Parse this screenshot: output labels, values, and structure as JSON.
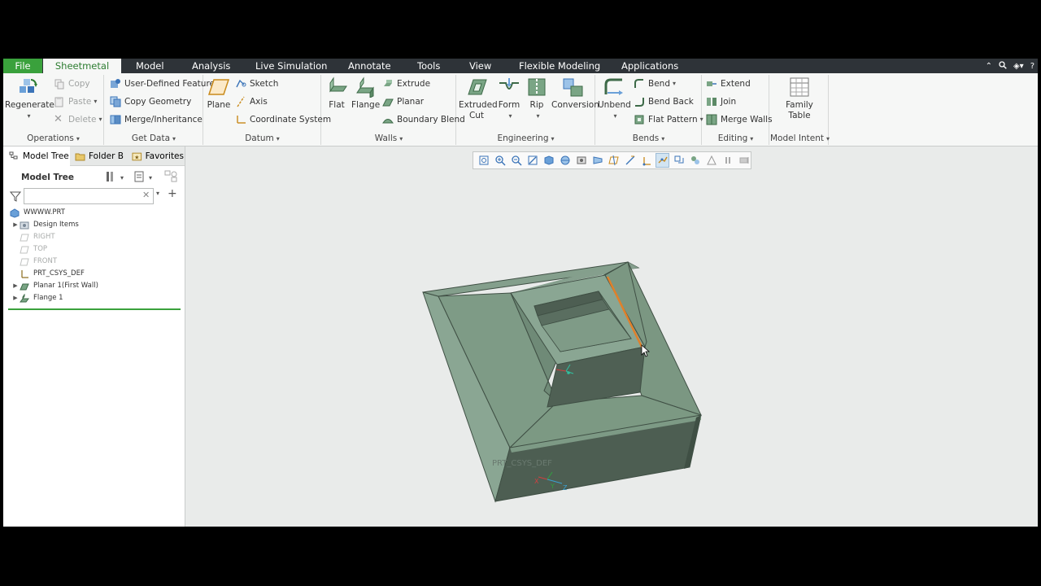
{
  "menu": {
    "file": "File",
    "tabs": [
      "Sheetmetal",
      "Model",
      "Analysis",
      "Live Simulation",
      "Annotate",
      "Tools",
      "View",
      "Flexible Modeling",
      "Applications"
    ],
    "right_icons": [
      "collapse-ribbon-icon",
      "search-icon",
      "settings-icon",
      "help-icon"
    ]
  },
  "ribbon": {
    "operations": {
      "label": "Operations",
      "regenerate": "Regenerate",
      "copy": "Copy",
      "paste": "Paste",
      "delete": "Delete"
    },
    "get_data": {
      "label": "Get Data",
      "udf": "User-Defined Feature",
      "copy_geometry": "Copy Geometry",
      "merge": "Merge/Inheritance"
    },
    "datum": {
      "label": "Datum",
      "plane": "Plane",
      "sketch": "Sketch",
      "axis": "Axis",
      "csys": "Coordinate System"
    },
    "walls": {
      "label": "Walls",
      "flat": "Flat",
      "flange": "Flange",
      "extrude": "Extrude",
      "planar": "Planar",
      "boundary_blend": "Boundary Blend"
    },
    "engineering": {
      "label": "Engineering",
      "extruded_cut_1": "Extruded",
      "extruded_cut_2": "Cut",
      "form": "Form",
      "rip": "Rip",
      "conversion": "Conversion"
    },
    "bends": {
      "label": "Bends",
      "unbend": "Unbend",
      "bend": "Bend",
      "bend_back": "Bend Back",
      "flat_pattern": "Flat Pattern"
    },
    "editing": {
      "label": "Editing",
      "extend": "Extend",
      "join": "Join",
      "merge_walls": "Merge Walls"
    },
    "model_intent": {
      "label": "Model Intent",
      "family_table_1": "Family",
      "family_table_2": "Table"
    }
  },
  "left_panel": {
    "tabs": [
      "Model Tree",
      "Folder B",
      "Favorites"
    ],
    "header": "Model Tree",
    "search": {
      "value": "",
      "placeholder": ""
    },
    "tree": [
      {
        "label": "WWWW.PRT",
        "dim": false,
        "expandable": false
      },
      {
        "label": "Design Items",
        "dim": false,
        "expandable": true
      },
      {
        "label": "RIGHT",
        "dim": true,
        "expandable": false
      },
      {
        "label": "TOP",
        "dim": true,
        "expandable": false
      },
      {
        "label": "FRONT",
        "dim": true,
        "expandable": false
      },
      {
        "label": "PRT_CSYS_DEF",
        "dim": false,
        "expandable": false
      },
      {
        "label": "Planar 1(First Wall)",
        "dim": false,
        "expandable": true
      },
      {
        "label": "Flange 1",
        "dim": false,
        "expandable": true
      }
    ]
  },
  "viewport": {
    "csys_label": "PRT_CSYS_DEF",
    "axis_labels": {
      "x": "X",
      "y": "Y",
      "z": "Z"
    }
  },
  "colors": {
    "file_tab": "#3aa13c",
    "menubar": "#2e3338",
    "active_tab_text": "#2e7d32",
    "part_light": "#7d9a85",
    "part_mid": "#6a8772",
    "part_dark": "#4c5f52",
    "edge_highlight": "#e0802a"
  }
}
